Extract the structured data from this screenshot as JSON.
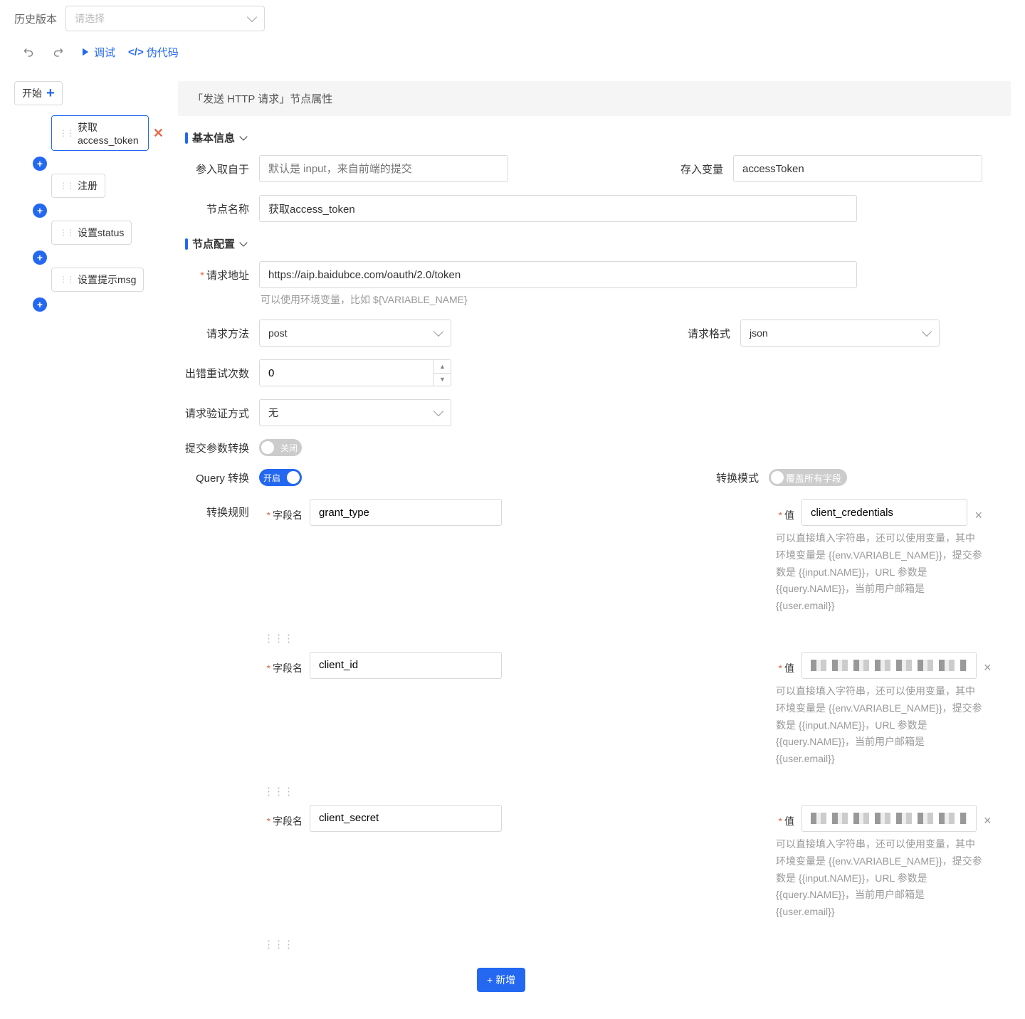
{
  "topbar": {
    "version_label": "历史版本",
    "version_placeholder": "请选择"
  },
  "actions": {
    "debug": "调试",
    "pseudocode": "伪代码"
  },
  "tree": {
    "root": "开始",
    "nodes": [
      "获取access_token",
      "注册",
      "设置status",
      "设置提示msg"
    ]
  },
  "panel": {
    "title": "「发送 HTTP 请求」节点属性",
    "sections": {
      "basic": "基本信息",
      "config": "节点配置"
    },
    "labels": {
      "input_from": "参入取自于",
      "input_placeholder": "默认是 input，来自前端的提交",
      "store_to": "存入变量",
      "node_name": "节点名称",
      "request_url": "请求地址",
      "url_hint": "可以使用环境变量，比如 ${VARIABLE_NAME}",
      "method": "请求方法",
      "format": "请求格式",
      "retry": "出错重试次数",
      "auth": "请求验证方式",
      "param_convert": "提交参数转换",
      "query_convert": "Query 转换",
      "convert_mode": "转换模式",
      "convert_rule": "转换规则",
      "field_name": "字段名",
      "value": "值",
      "add_new": "新增"
    },
    "values": {
      "store_to": "accessToken",
      "node_name": "获取access_token",
      "request_url": "https://aip.baidubce.com/oauth/2.0/token",
      "method": "post",
      "format": "json",
      "retry": "0",
      "auth": "无",
      "toggle_on": "开启",
      "toggle_off": "关闭",
      "overwrite_all": "覆盖所有字段"
    },
    "rules": [
      {
        "field": "grant_type",
        "value": "client_credentials",
        "redacted": false
      },
      {
        "field": "client_id",
        "value": "",
        "redacted": true
      },
      {
        "field": "client_secret",
        "value": "",
        "redacted": true
      }
    ],
    "value_hint": "可以直接填入字符串，还可以使用变量，其中环境变量是 {{env.VARIABLE_NAME}}，提交参数是 {{input.NAME}}，URL 参数是 {{query.NAME}}，当前用户邮箱是 {{user.email}}"
  }
}
